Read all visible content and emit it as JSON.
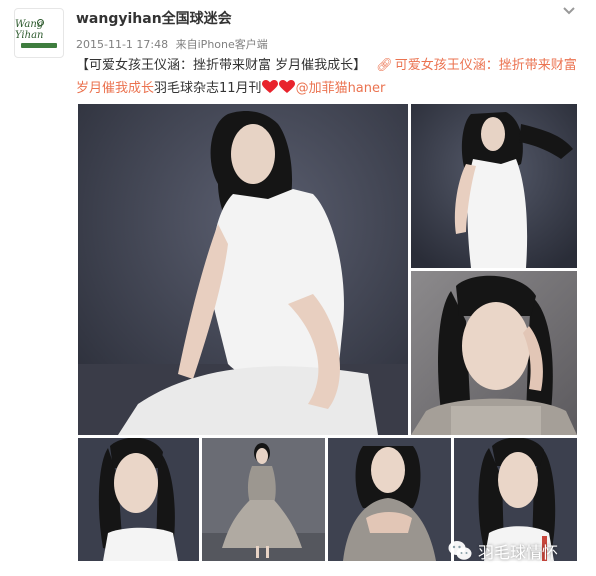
{
  "post": {
    "author": "wangyihan全国球迷会",
    "timestamp": "2015-11-1 17:48",
    "source_prefix": "来自",
    "source_app": "iPhone客户端",
    "text_title": "【可爱女孩王仪涵：挫折带来财富 岁月催我成长】",
    "link_text": "可爱女孩王仪涵：挫折带来财富 岁月催我成长",
    "text_tail": "羽毛球杂志11月刊",
    "mention": "@加菲猫haner",
    "avatar_logo_text": "Wang Yihan"
  },
  "photos": [
    {
      "label": "photo-1"
    },
    {
      "label": "photo-2"
    },
    {
      "label": "photo-3"
    },
    {
      "label": "photo-4"
    },
    {
      "label": "photo-5"
    },
    {
      "label": "photo-6"
    },
    {
      "label": "photo-7"
    }
  ],
  "watermark": {
    "text": "羽毛球情怀"
  },
  "colors": {
    "link": "#eb7350",
    "heart": "#e8232c",
    "backdrop": "#3a3d4a"
  }
}
